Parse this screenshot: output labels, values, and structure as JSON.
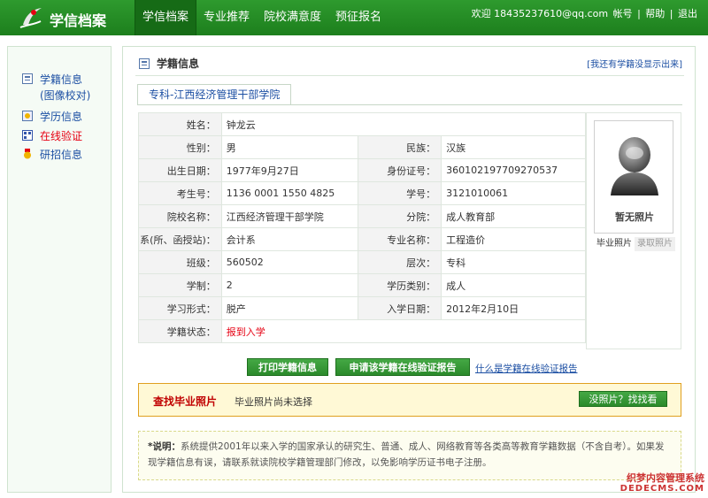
{
  "header": {
    "brand": "学信档案",
    "nav": [
      "学信档案",
      "专业推荐",
      "院校满意度",
      "预征报名"
    ],
    "user_welcome": "欢迎 18435237610@qq.com",
    "account": "帐号",
    "help": "帮助",
    "logout": "退出"
  },
  "sidebar": {
    "items": [
      {
        "label": "学籍信息",
        "sub": "(图像校对)"
      },
      {
        "label": "学历信息"
      },
      {
        "label": "在线验证"
      },
      {
        "label": "研招信息"
      }
    ]
  },
  "main": {
    "title": "学籍信息",
    "missing_link": "[我还有学籍没显示出来]",
    "tab": "专科-江西经济管理干部学院",
    "fields": {
      "name_label": "姓名：",
      "name": "钟龙云",
      "gender_label": "性别：",
      "gender": "男",
      "ethnic_label": "民族：",
      "ethnic": "汉族",
      "birth_label": "出生日期：",
      "birth": "1977年9月27日",
      "id_label": "身份证号：",
      "id": "360102197709270537",
      "exam_label": "考生号：",
      "exam": "1136 0001 1550 4825",
      "student_label": "学号：",
      "student": "3121010061",
      "school_label": "院校名称：",
      "school": "江西经济管理干部学院",
      "branch_label": "分院：",
      "branch": "成人教育部",
      "dept_label": "系(所、函授站)：",
      "dept": "会计系",
      "major_label": "专业名称：",
      "major": "工程造价",
      "class_label": "班级：",
      "class": "560502",
      "level_label": "层次：",
      "level": "专科",
      "length_label": "学制：",
      "length": "2",
      "type_label": "学历类别：",
      "type": "成人",
      "form_label": "学习形式：",
      "form": "脱产",
      "enroll_label": "入学日期：",
      "enroll": "2012年2月10日",
      "status_label": "学籍状态：",
      "status": "报到入学"
    },
    "photo": {
      "caption": "暂无照片",
      "tab_grad": "毕业照片",
      "tab_enroll": "录取照片"
    },
    "buttons": {
      "print": "打印学籍信息",
      "apply": "申请该学籍在线验证报告",
      "what_link": "什么是学籍在线验证报告",
      "no_photo": "没照片？找找看"
    },
    "find": {
      "title": "查找毕业照片",
      "msg": "毕业照片尚未选择"
    },
    "note": {
      "label": "*说明：",
      "text": "系统提供2001年以来入学的国家承认的研究生、普通、成人、网络教育等各类高等教育学籍数据（不含自考）。如果发现学籍信息有误，请联系就读院校学籍管理部门修改，以免影响学历证书电子注册。"
    }
  },
  "watermark": {
    "line1": "织梦内容管理系统",
    "line2": "DEDECMS.COM"
  }
}
